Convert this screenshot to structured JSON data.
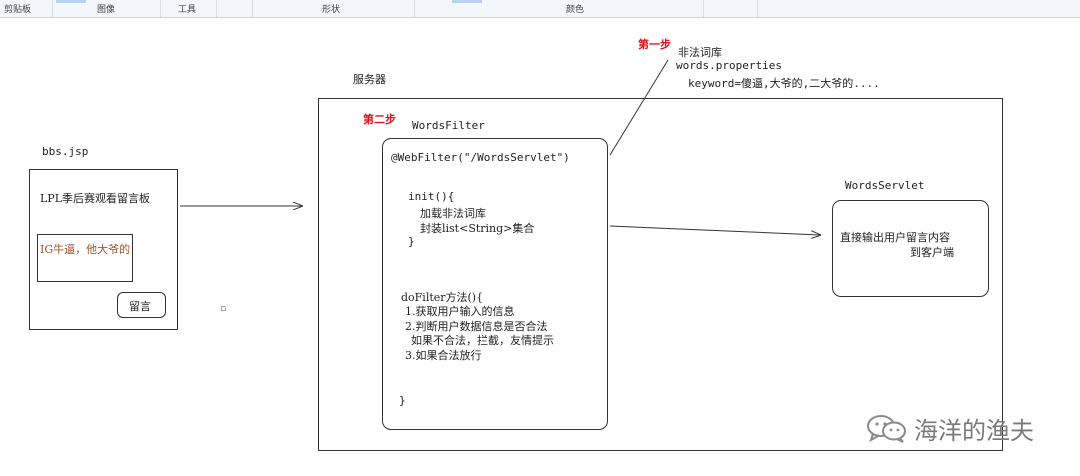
{
  "ribbon": {
    "groups": [
      "剪贴板",
      "图像",
      "工具",
      "形状",
      "颜色"
    ]
  },
  "canvas": {
    "step1": "第一步",
    "step2": "第二步",
    "server_label": "服务器",
    "dict": {
      "title": "非法词库",
      "file": "words.properties",
      "keyword": "keyword=傻逼,大爷的,二大爷的...."
    },
    "bbs": {
      "file_label": "bbs.jsp",
      "board_title": "LPL季后赛观看留言板",
      "comment_text": "IG牛逼，他大爷的",
      "submit_button": "留言"
    },
    "filter": {
      "title": "WordsFilter",
      "annotation": "@WebFilter(\"/WordsServlet\")",
      "init_open": "init(){",
      "init_line1": "加载非法词库",
      "init_line2": "封装list<String>集合",
      "init_close": "}",
      "do_open": "doFilter方法(){",
      "do_line1": "1.获取用户输入的信息",
      "do_line2": "2.判断用户数据信息是否合法",
      "do_line3": "如果不合法，拦截，友情提示",
      "do_line4": "3.如果合法放行",
      "do_close": "}"
    },
    "servlet": {
      "title": "WordsServlet",
      "line1": "直接输出用户留言内容",
      "line2": "到客户端"
    },
    "small_mark": "▫"
  },
  "watermark": {
    "text": "海洋的渔夫",
    "icon": "wechat-icon"
  },
  "colors": {
    "step_red": "#e0141e",
    "comment_text": "#a0522d",
    "ribbon_bg": "#f3f6fa",
    "watermark": "#7a7a7a"
  }
}
